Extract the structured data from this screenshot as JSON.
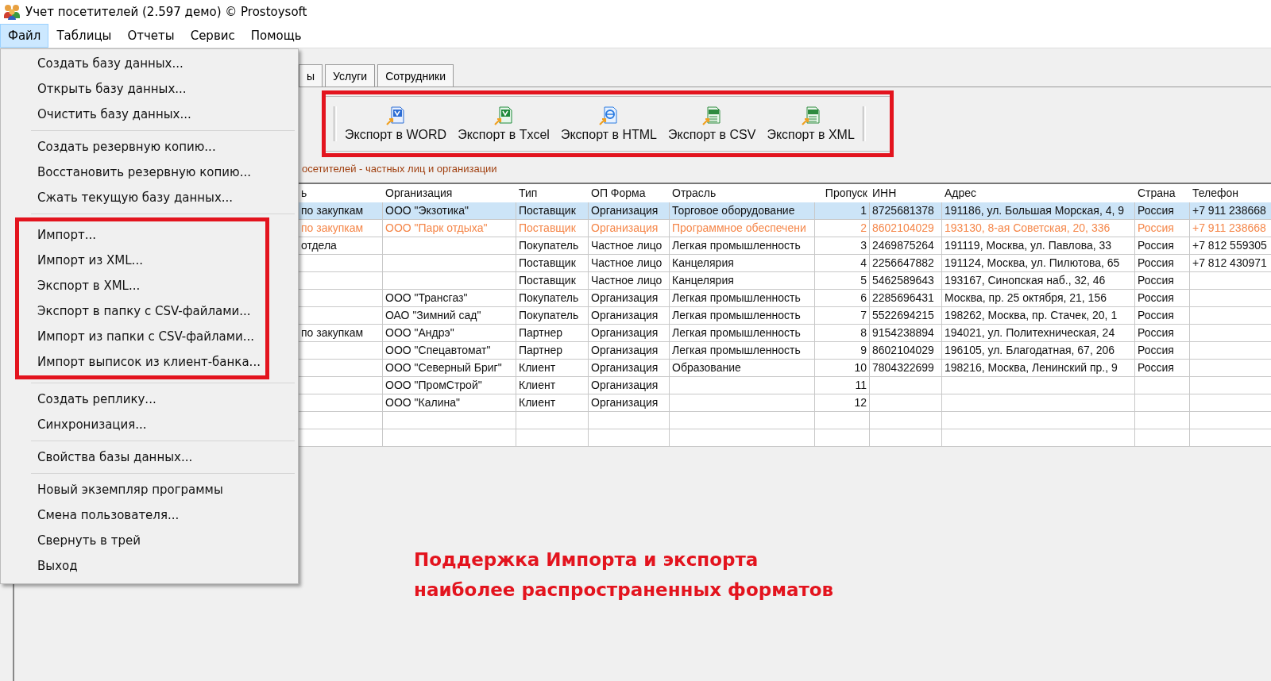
{
  "window": {
    "title": "Учет посетителей (2.597 демо) © Prostoysoft"
  },
  "menu_bar": [
    {
      "label": "Файл",
      "selected": true
    },
    {
      "label": "Таблицы",
      "selected": false
    },
    {
      "label": "Отчеты",
      "selected": false
    },
    {
      "label": "Сервис",
      "selected": false
    },
    {
      "label": "Помощь",
      "selected": false
    }
  ],
  "file_menu": {
    "groups": [
      {
        "framed": false,
        "items": [
          "Создать базу данных...",
          "Открыть базу данных...",
          "Очистить базу данных..."
        ]
      },
      {
        "framed": false,
        "items": [
          "Создать резервную копию...",
          "Восстановить резервную копию...",
          "Сжать текущую базу данных..."
        ]
      },
      {
        "framed": true,
        "items": [
          "Импорт...",
          "Импорт из XML...",
          "Экспорт в XML...",
          "Экспорт в папку с CSV-файлами...",
          "Импорт из папки с CSV-файлами...",
          "Импорт выписок из клиент-банка..."
        ]
      },
      {
        "framed": false,
        "items": [
          "Создать реплику...",
          "Синхронизация..."
        ]
      },
      {
        "framed": false,
        "items": [
          "Свойства базы данных..."
        ]
      },
      {
        "framed": false,
        "items": [
          "Новый экземпляр программы",
          "Смена пользователя...",
          "Свернуть в трей",
          "Выход"
        ]
      }
    ]
  },
  "tabs": [
    {
      "label": "ы",
      "selected": false
    },
    {
      "label": "Услуги",
      "selected": false
    },
    {
      "label": "Сотрудники",
      "selected": false
    }
  ],
  "toolbar": {
    "framed": true,
    "buttons": [
      {
        "label": "Экспорт в WORD",
        "kind": "word"
      },
      {
        "label": "Экспорт в Txcel",
        "kind": "excel"
      },
      {
        "label": "Экспорт в HTML",
        "kind": "html"
      },
      {
        "label": "Экспорт в CSV",
        "kind": "csv"
      },
      {
        "label": "Экспорт в XML",
        "kind": "xml"
      }
    ]
  },
  "table_caption": "осетителей - частных лиц и организации",
  "table": {
    "columns": [
      "ь",
      "Организация",
      "Тип",
      "ОП Форма",
      "Отрасль",
      "Пропуск",
      "ИНН",
      "Адрес",
      "Страна",
      "Телефон"
    ],
    "rows": [
      {
        "selected": true,
        "marked": false,
        "cells": [
          "по закупкам",
          "ООО \"Экзотика\"",
          "Поставщик",
          "Организация",
          "Торговое оборудование",
          "1",
          "8725681378",
          "191186, ул. Большая Морская, 4, 9",
          "Россия",
          "+7 911 238668"
        ]
      },
      {
        "selected": false,
        "marked": true,
        "cells": [
          "по закупкам",
          "ООО \"Парк отдыха\"",
          "Поставщик",
          "Организация",
          "Программное обеспечени",
          "2",
          "8602104029",
          "193130, 8-ая Советская, 20, 336",
          "Россия",
          "+7 911 238668"
        ]
      },
      {
        "selected": false,
        "marked": false,
        "cells": [
          "отдела",
          "",
          "Покупатель",
          "Частное лицо",
          "Легкая промышленность",
          "3",
          "2469875264",
          "191119, Москва, ул. Павлова, 33",
          "Россия",
          "+7 812 559305"
        ]
      },
      {
        "selected": false,
        "marked": false,
        "cells": [
          "",
          "",
          "Поставщик",
          "Частное лицо",
          "Канцелярия",
          "4",
          "2256647882",
          "191124, Москва, ул. Пилютова, 65",
          "Россия",
          "+7 812 430971"
        ]
      },
      {
        "selected": false,
        "marked": false,
        "cells": [
          "",
          "",
          "Поставщик",
          "Частное лицо",
          "Канцелярия",
          "5",
          "5462589643",
          "193167, Синопская наб., 32, 46",
          "Россия",
          ""
        ]
      },
      {
        "selected": false,
        "marked": false,
        "cells": [
          "",
          "ООО \"Трансгаз\"",
          "Покупатель",
          "Организация",
          "Легкая промышленность",
          "6",
          "2285696431",
          "Москва, пр. 25 октября, 21, 156",
          "Россия",
          ""
        ]
      },
      {
        "selected": false,
        "marked": false,
        "cells": [
          "",
          "ОАО \"Зимний сад\"",
          "Покупатель",
          "Организация",
          "Легкая промышленность",
          "7",
          "5522694215",
          "198262, Москва, пр. Стачек, 20, 1",
          "Россия",
          ""
        ]
      },
      {
        "selected": false,
        "marked": false,
        "cells": [
          "по закупкам",
          "ООО \"Андрэ\"",
          "Партнер",
          "Организация",
          "Легкая промышленность",
          "8",
          "9154238894",
          "194021, ул. Политехническая, 24",
          "Россия",
          ""
        ]
      },
      {
        "selected": false,
        "marked": false,
        "cells": [
          "",
          "ООО \"Спецавтомат\"",
          "Партнер",
          "Организация",
          "Легкая промышленность",
          "9",
          "8602104029",
          "196105, ул. Благодатная, 67, 206",
          "Россия",
          ""
        ]
      },
      {
        "selected": false,
        "marked": false,
        "cells": [
          "",
          "ООО \"Северный Бриг\"",
          "Клиент",
          "Организация",
          "Образование",
          "10",
          "7804322699",
          "198216, Москва, Ленинский пр., 9",
          "Россия",
          ""
        ]
      },
      {
        "selected": false,
        "marked": false,
        "cells": [
          "",
          "ООО \"ПромСтрой\"",
          "Клиент",
          "Организация",
          "",
          "11",
          "",
          "",
          "",
          ""
        ]
      },
      {
        "selected": false,
        "marked": false,
        "cells": [
          "",
          "ООО \"Калина\"",
          "Клиент",
          "Организация",
          "",
          "12",
          "",
          "",
          "",
          ""
        ]
      }
    ]
  },
  "promo_text": [
    "Поддержка Импорта и экспорта",
    "наиболее распространенных форматов"
  ]
}
